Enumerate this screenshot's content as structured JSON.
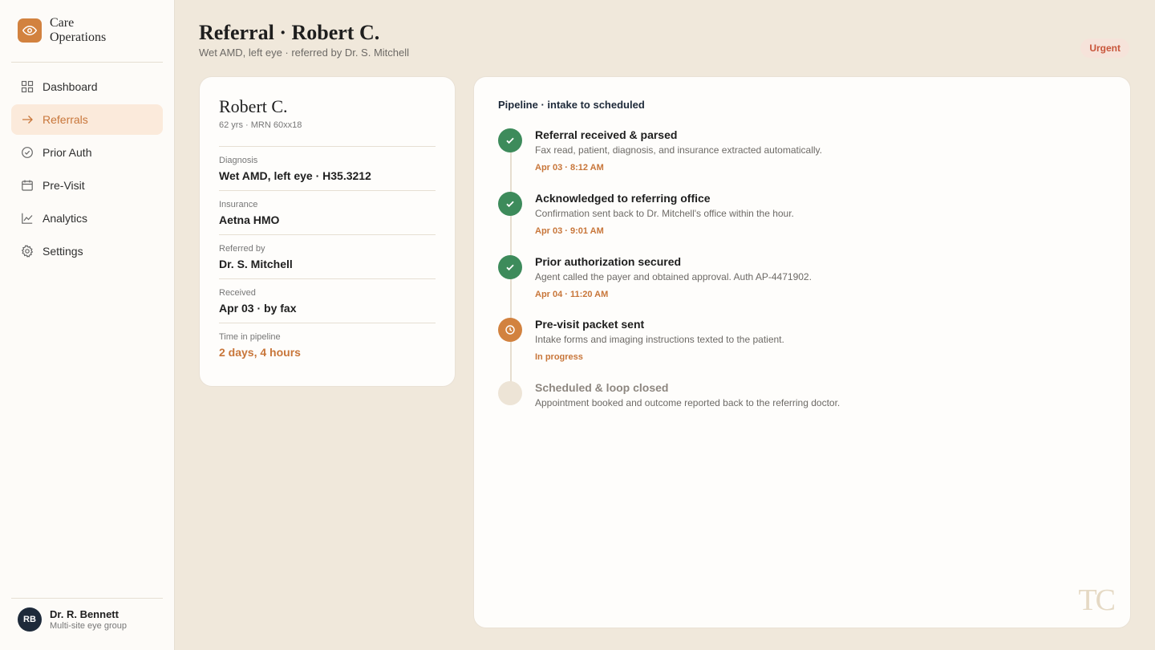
{
  "brand": {
    "name_line1": "Care",
    "name_line2": "Operations",
    "logo_icon": "eye-icon",
    "accent": "#D2823F"
  },
  "nav": {
    "items": [
      {
        "label": "Dashboard",
        "icon": "grid-icon",
        "active": false
      },
      {
        "label": "Referrals",
        "icon": "arrow-right-icon",
        "active": true
      },
      {
        "label": "Prior Auth",
        "icon": "check-circle-icon",
        "active": false
      },
      {
        "label": "Pre-Visit",
        "icon": "calendar-icon",
        "active": false
      },
      {
        "label": "Analytics",
        "icon": "chart-line-icon",
        "active": false
      },
      {
        "label": "Settings",
        "icon": "gear-icon",
        "active": false
      }
    ]
  },
  "user": {
    "initials": "RB",
    "name": "Dr. R. Bennett",
    "org": "Multi-site eye group"
  },
  "header": {
    "title": "Referral · Robert C.",
    "subtitle": "Wet AMD, left eye · referred by Dr. S. Mitchell",
    "badge": "Urgent"
  },
  "patient": {
    "name": "Robert C.",
    "meta": "62 yrs · MRN 60xx18",
    "fields": [
      {
        "label": "Diagnosis",
        "value": "Wet AMD, left eye · H35.3212"
      },
      {
        "label": "Insurance",
        "value": "Aetna HMO"
      },
      {
        "label": "Referred by",
        "value": "Dr. S. Mitchell"
      },
      {
        "label": "Received",
        "value": "Apr 03 · by fax"
      },
      {
        "label": "Time in pipeline",
        "value": "2 days, 4 hours"
      }
    ]
  },
  "pipeline": {
    "title": "Pipeline · intake to scheduled",
    "steps": [
      {
        "status": "done",
        "title": "Referral received & parsed",
        "desc": "Fax read, patient, diagnosis, and insurance extracted automatically.",
        "time": "Apr 03 · 8:12 AM"
      },
      {
        "status": "done",
        "title": "Acknowledged to referring office",
        "desc": "Confirmation sent back to Dr. Mitchell's office within the hour.",
        "time": "Apr 03 · 9:01 AM"
      },
      {
        "status": "done",
        "title": "Prior authorization secured",
        "desc": "Agent called the payer and obtained approval. Auth AP-4471902.",
        "time": "Apr 04 · 11:20 AM"
      },
      {
        "status": "progress",
        "title": "Pre-visit packet sent",
        "desc": "Intake forms and imaging instructions texted to the patient.",
        "time": "In progress"
      },
      {
        "status": "pending",
        "title": "Scheduled & loop closed",
        "desc": "Appointment booked and outcome reported back to the referring doctor.",
        "time": ""
      }
    ]
  },
  "watermark": "TC"
}
